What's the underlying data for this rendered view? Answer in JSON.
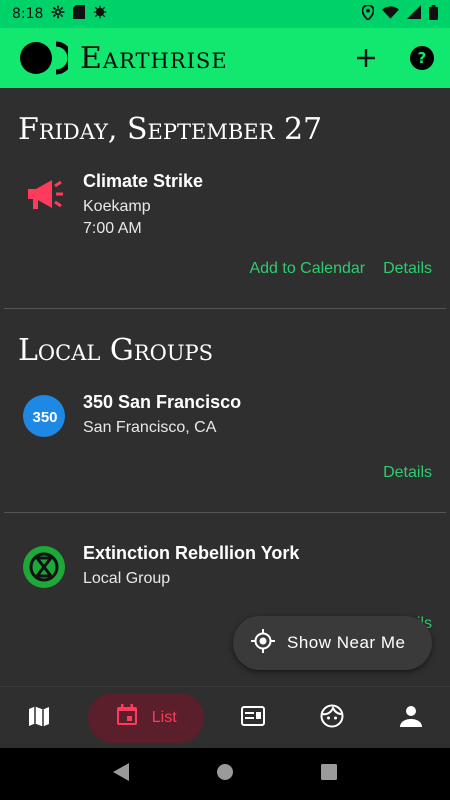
{
  "status_bar": {
    "time": "8:18"
  },
  "app_bar": {
    "title": "Earthrise"
  },
  "events_section": {
    "date_heading": "Friday, September 27",
    "event": {
      "title": "Climate Strike",
      "location": "Koekamp",
      "time": "7:00 AM"
    },
    "actions": {
      "add_to_calendar": "Add to Calendar",
      "details": "Details"
    }
  },
  "groups_section": {
    "heading": "Local Groups",
    "groups": [
      {
        "name": "350 San Francisco",
        "subtitle": "San Francisco, CA",
        "badge": "350",
        "details": "Details"
      },
      {
        "name": "Extinction Rebellion York",
        "subtitle": "Local Group",
        "details": "Details"
      }
    ]
  },
  "fab": {
    "label": "Show Near Me"
  },
  "bottom_nav": {
    "active_label": "List"
  },
  "colors": {
    "brand_green": "#12e870",
    "accent_red": "#ff3b5c",
    "link_green": "#2ecc71",
    "badge_blue": "#1e88e5"
  }
}
